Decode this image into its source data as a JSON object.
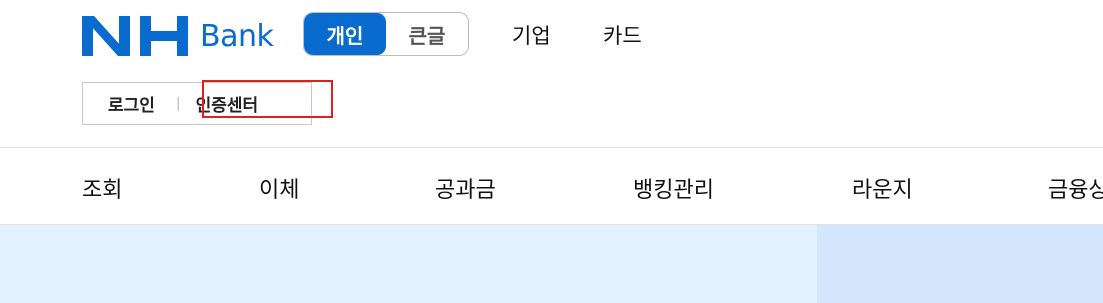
{
  "brand": {
    "name": "NH Bank",
    "mark": "NH",
    "word": "Bank",
    "color": "#0a6bcf"
  },
  "mode_toggle": {
    "options": [
      {
        "label": "개인",
        "active": true
      },
      {
        "label": "큰글",
        "active": false
      }
    ]
  },
  "top_links": [
    "기업",
    "카드"
  ],
  "sub_links": {
    "login": "로그인",
    "separator": "|",
    "cert_center": "인증센터"
  },
  "nav": {
    "items": [
      "조회",
      "이체",
      "공과금",
      "뱅킹관리",
      "라운지",
      "금융상"
    ]
  },
  "colors": {
    "accent": "#0a6bcf",
    "focus_outline": "#e02020",
    "hero_left": "#e3f0fd",
    "hero_right": "#d4e6fc"
  }
}
